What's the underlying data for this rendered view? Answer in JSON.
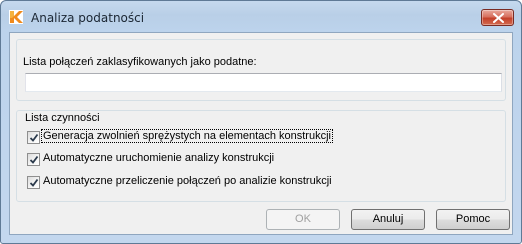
{
  "window": {
    "title": "Analiza podatności",
    "app_icon": "app-logo-icon",
    "close_icon": "close-icon"
  },
  "connections": {
    "label": "Lista połączeń zaklasyfikowanych jako podatne:",
    "value": ""
  },
  "actions": {
    "legend": "Lista czynności",
    "items": [
      {
        "label": "Generacja zwolnień sprężystych na elementach konstrukcji",
        "checked": true
      },
      {
        "label": "Automatyczne uruchomienie analizy konstrukcji",
        "checked": true
      },
      {
        "label": "Automatyczne przeliczenie połączeń po analizie konstrukcji",
        "checked": true
      }
    ]
  },
  "buttons": {
    "ok": "OK",
    "cancel": "Anuluj",
    "help": "Pomoc"
  },
  "colors": {
    "titlebar": "#b9cfe7",
    "close_button": "#c4412b",
    "dialog_bg": "#f0f0f0"
  }
}
